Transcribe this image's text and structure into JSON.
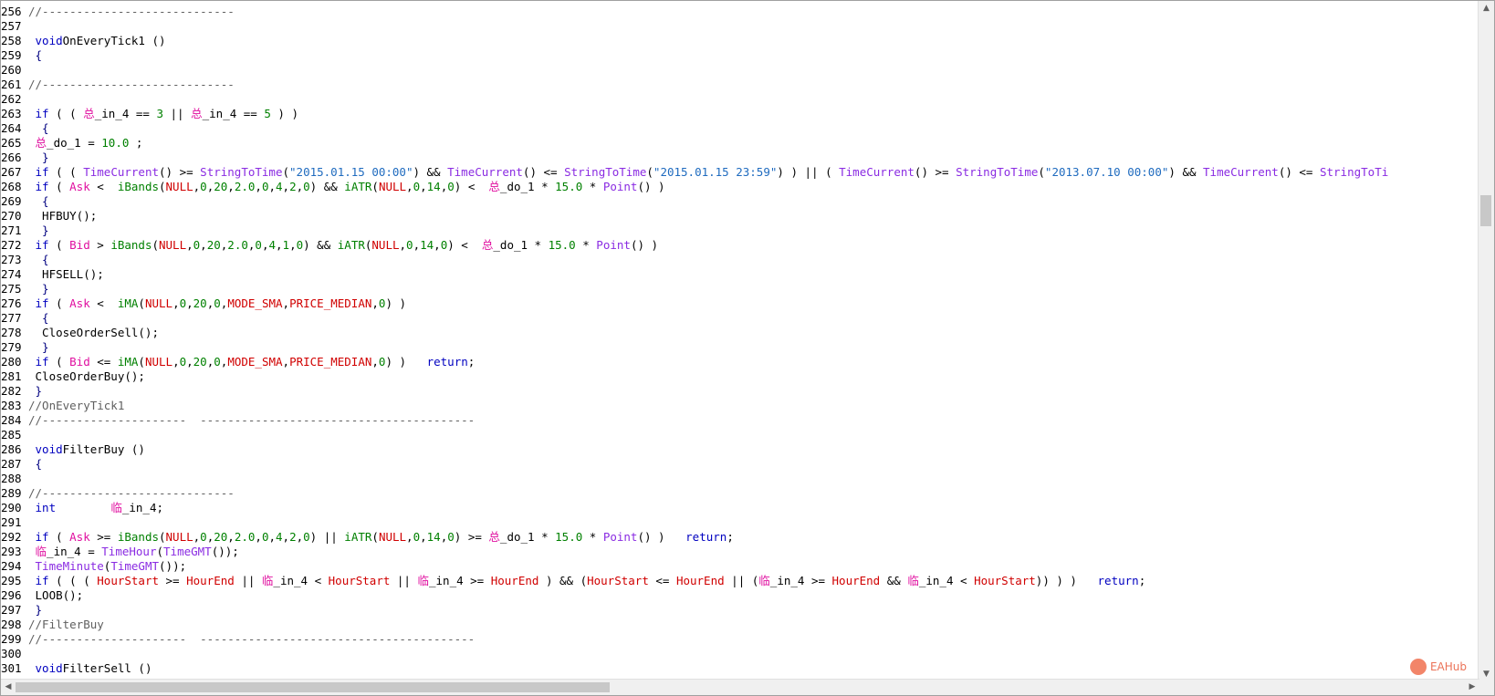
{
  "editor": {
    "lines": [
      {
        "n": "256",
        "t": [
          [
            "cm",
            "//----------------------------"
          ]
        ]
      },
      {
        "n": "257",
        "t": []
      },
      {
        "n": "258",
        "t": [
          [
            "kw",
            " void"
          ],
          [
            "",
            "OnEveryTick1 ()"
          ]
        ]
      },
      {
        "n": "259",
        "t": [
          [
            "op",
            " {"
          ]
        ]
      },
      {
        "n": "260",
        "t": []
      },
      {
        "n": "261",
        "t": [
          [
            "cm",
            "//----------------------------"
          ]
        ]
      },
      {
        "n": "262",
        "t": []
      },
      {
        "n": "263",
        "t": [
          [
            "kw",
            " if"
          ],
          [
            "",
            " ( ( "
          ],
          [
            "cjk",
            "总"
          ],
          [
            "",
            "_in_4 == "
          ],
          [
            "nm",
            "3"
          ],
          [
            "",
            " || "
          ],
          [
            "cjk",
            "总"
          ],
          [
            "",
            "_in_4 == "
          ],
          [
            "nm",
            "5"
          ],
          [
            "",
            " ) )"
          ]
        ]
      },
      {
        "n": "264",
        "t": [
          [
            "op",
            "  {"
          ]
        ]
      },
      {
        "n": "265",
        "t": [
          [
            "",
            " "
          ],
          [
            "cjk",
            "总"
          ],
          [
            "",
            "_do_1 = "
          ],
          [
            "nm",
            "10.0"
          ],
          [
            "",
            " ;"
          ]
        ]
      },
      {
        "n": "266",
        "t": [
          [
            "op",
            "  }"
          ]
        ]
      },
      {
        "n": "267",
        "t": [
          [
            "kw",
            " if"
          ],
          [
            "",
            " ( ( "
          ],
          [
            "fn",
            "TimeCurrent"
          ],
          [
            "",
            "() >= "
          ],
          [
            "fn",
            "StringToTime"
          ],
          [
            "",
            "("
          ],
          [
            "st",
            "\"2015.01.15 00:00\""
          ],
          [
            "",
            ") && "
          ],
          [
            "fn",
            "TimeCurrent"
          ],
          [
            "",
            "() <= "
          ],
          [
            "fn",
            "StringToTime"
          ],
          [
            "",
            "("
          ],
          [
            "st",
            "\"2015.01.15 23:59\""
          ],
          [
            "",
            ") ) || ( "
          ],
          [
            "fn",
            "TimeCurrent"
          ],
          [
            "",
            "() >= "
          ],
          [
            "fn",
            "StringToTime"
          ],
          [
            "",
            "("
          ],
          [
            "st",
            "\"2013.07.10 00:00\""
          ],
          [
            "",
            ") && "
          ],
          [
            "fn",
            "TimeCurrent"
          ],
          [
            "",
            "() <= "
          ],
          [
            "fn",
            "StringToTi"
          ]
        ]
      },
      {
        "n": "268",
        "t": [
          [
            "kw",
            " if"
          ],
          [
            "",
            " ( "
          ],
          [
            "pv",
            "Ask"
          ],
          [
            "",
            " <  "
          ],
          [
            "nm",
            "iBands"
          ],
          [
            "",
            "("
          ],
          [
            "cn",
            "NULL"
          ],
          [
            "",
            ","
          ],
          [
            "nm",
            "0"
          ],
          [
            "",
            ","
          ],
          [
            "nm",
            "20"
          ],
          [
            "",
            ","
          ],
          [
            "nm",
            "2.0"
          ],
          [
            "",
            ","
          ],
          [
            "nm",
            "0"
          ],
          [
            "",
            ","
          ],
          [
            "nm",
            "4"
          ],
          [
            "",
            ","
          ],
          [
            "nm",
            "2"
          ],
          [
            "",
            ","
          ],
          [
            "nm",
            "0"
          ],
          [
            "",
            ") && "
          ],
          [
            "nm",
            "iATR"
          ],
          [
            "",
            "("
          ],
          [
            "cn",
            "NULL"
          ],
          [
            "",
            ","
          ],
          [
            "nm",
            "0"
          ],
          [
            "",
            ","
          ],
          [
            "nm",
            "14"
          ],
          [
            "",
            ","
          ],
          [
            "nm",
            "0"
          ],
          [
            "",
            ") <  "
          ],
          [
            "cjk",
            "总"
          ],
          [
            "",
            "_do_1 * "
          ],
          [
            "nm",
            "15.0"
          ],
          [
            "",
            " * "
          ],
          [
            "fn",
            "Point"
          ],
          [
            "",
            "() )"
          ]
        ]
      },
      {
        "n": "269",
        "t": [
          [
            "op",
            "  {"
          ]
        ]
      },
      {
        "n": "270",
        "t": [
          [
            "",
            "  HFBUY();"
          ]
        ]
      },
      {
        "n": "271",
        "t": [
          [
            "op",
            "  }"
          ]
        ]
      },
      {
        "n": "272",
        "t": [
          [
            "kw",
            " if"
          ],
          [
            "",
            " ( "
          ],
          [
            "pv",
            "Bid"
          ],
          [
            "",
            " > "
          ],
          [
            "nm",
            "iBands"
          ],
          [
            "",
            "("
          ],
          [
            "cn",
            "NULL"
          ],
          [
            "",
            ","
          ],
          [
            "nm",
            "0"
          ],
          [
            "",
            ","
          ],
          [
            "nm",
            "20"
          ],
          [
            "",
            ","
          ],
          [
            "nm",
            "2.0"
          ],
          [
            "",
            ","
          ],
          [
            "nm",
            "0"
          ],
          [
            "",
            ","
          ],
          [
            "nm",
            "4"
          ],
          [
            "",
            ","
          ],
          [
            "nm",
            "1"
          ],
          [
            "",
            ","
          ],
          [
            "nm",
            "0"
          ],
          [
            "",
            ") && "
          ],
          [
            "nm",
            "iATR"
          ],
          [
            "",
            "("
          ],
          [
            "cn",
            "NULL"
          ],
          [
            "",
            ","
          ],
          [
            "nm",
            "0"
          ],
          [
            "",
            ","
          ],
          [
            "nm",
            "14"
          ],
          [
            "",
            ","
          ],
          [
            "nm",
            "0"
          ],
          [
            "",
            ") <  "
          ],
          [
            "cjk",
            "总"
          ],
          [
            "",
            "_do_1 * "
          ],
          [
            "nm",
            "15.0"
          ],
          [
            "",
            " * "
          ],
          [
            "fn",
            "Point"
          ],
          [
            "",
            "() )"
          ]
        ]
      },
      {
        "n": "273",
        "t": [
          [
            "op",
            "  {"
          ]
        ]
      },
      {
        "n": "274",
        "t": [
          [
            "",
            "  HFSELL();"
          ]
        ]
      },
      {
        "n": "275",
        "t": [
          [
            "op",
            "  }"
          ]
        ]
      },
      {
        "n": "276",
        "t": [
          [
            "kw",
            " if"
          ],
          [
            "",
            " ( "
          ],
          [
            "pv",
            "Ask"
          ],
          [
            "",
            " <  "
          ],
          [
            "nm",
            "iMA"
          ],
          [
            "",
            "("
          ],
          [
            "cn",
            "NULL"
          ],
          [
            "",
            ","
          ],
          [
            "nm",
            "0"
          ],
          [
            "",
            ","
          ],
          [
            "nm",
            "20"
          ],
          [
            "",
            ","
          ],
          [
            "nm",
            "0"
          ],
          [
            "",
            ","
          ],
          [
            "cn",
            "MODE_SMA"
          ],
          [
            "",
            ","
          ],
          [
            "cn",
            "PRICE_MEDIAN"
          ],
          [
            "",
            ","
          ],
          [
            "nm",
            "0"
          ],
          [
            "",
            ") )"
          ]
        ]
      },
      {
        "n": "277",
        "t": [
          [
            "op",
            "  {"
          ]
        ]
      },
      {
        "n": "278",
        "t": [
          [
            "",
            "  CloseOrderSell();"
          ]
        ]
      },
      {
        "n": "279",
        "t": [
          [
            "op",
            "  }"
          ]
        ]
      },
      {
        "n": "280",
        "t": [
          [
            "kw",
            " if"
          ],
          [
            "",
            " ( "
          ],
          [
            "pv",
            "Bid"
          ],
          [
            "",
            " <= "
          ],
          [
            "nm",
            "iMA"
          ],
          [
            "",
            "("
          ],
          [
            "cn",
            "NULL"
          ],
          [
            "",
            ","
          ],
          [
            "nm",
            "0"
          ],
          [
            "",
            ","
          ],
          [
            "nm",
            "20"
          ],
          [
            "",
            ","
          ],
          [
            "nm",
            "0"
          ],
          [
            "",
            ","
          ],
          [
            "cn",
            "MODE_SMA"
          ],
          [
            "",
            ","
          ],
          [
            "cn",
            "PRICE_MEDIAN"
          ],
          [
            "",
            ","
          ],
          [
            "nm",
            "0"
          ],
          [
            "",
            ") )   "
          ],
          [
            "kw",
            "return"
          ],
          [
            "",
            ";"
          ]
        ]
      },
      {
        "n": "281",
        "t": [
          [
            "",
            " CloseOrderBuy();"
          ]
        ]
      },
      {
        "n": "282",
        "t": [
          [
            "op",
            " }"
          ]
        ]
      },
      {
        "n": "283",
        "t": [
          [
            "cm",
            "//OnEveryTick1"
          ]
        ]
      },
      {
        "n": "284",
        "t": [
          [
            "cm",
            "//---------------------  ----------------------------------------"
          ]
        ]
      },
      {
        "n": "285",
        "t": []
      },
      {
        "n": "286",
        "t": [
          [
            "kw",
            " void"
          ],
          [
            "",
            "FilterBuy ()"
          ]
        ]
      },
      {
        "n": "287",
        "t": [
          [
            "op",
            " {"
          ]
        ]
      },
      {
        "n": "288",
        "t": []
      },
      {
        "n": "289",
        "t": [
          [
            "cm",
            "//----------------------------"
          ]
        ]
      },
      {
        "n": "290",
        "t": [
          [
            "kw",
            " int"
          ],
          [
            "",
            "        "
          ],
          [
            "cjk",
            "临"
          ],
          [
            "",
            "_in_4;"
          ]
        ]
      },
      {
        "n": "291",
        "t": []
      },
      {
        "n": "292",
        "t": [
          [
            "kw",
            " if"
          ],
          [
            "",
            " ( "
          ],
          [
            "pv",
            "Ask"
          ],
          [
            "",
            " >= "
          ],
          [
            "nm",
            "iBands"
          ],
          [
            "",
            "("
          ],
          [
            "cn",
            "NULL"
          ],
          [
            "",
            ","
          ],
          [
            "nm",
            "0"
          ],
          [
            "",
            ","
          ],
          [
            "nm",
            "20"
          ],
          [
            "",
            ","
          ],
          [
            "nm",
            "2.0"
          ],
          [
            "",
            ","
          ],
          [
            "nm",
            "0"
          ],
          [
            "",
            ","
          ],
          [
            "nm",
            "4"
          ],
          [
            "",
            ","
          ],
          [
            "nm",
            "2"
          ],
          [
            "",
            ","
          ],
          [
            "nm",
            "0"
          ],
          [
            "",
            ") || "
          ],
          [
            "nm",
            "iATR"
          ],
          [
            "",
            "("
          ],
          [
            "cn",
            "NULL"
          ],
          [
            "",
            ","
          ],
          [
            "nm",
            "0"
          ],
          [
            "",
            ","
          ],
          [
            "nm",
            "14"
          ],
          [
            "",
            ","
          ],
          [
            "nm",
            "0"
          ],
          [
            "",
            ") >= "
          ],
          [
            "cjk",
            "总"
          ],
          [
            "",
            "_do_1 * "
          ],
          [
            "nm",
            "15.0"
          ],
          [
            "",
            " * "
          ],
          [
            "fn",
            "Point"
          ],
          [
            "",
            "() )   "
          ],
          [
            "kw",
            "return"
          ],
          [
            "",
            ";"
          ]
        ]
      },
      {
        "n": "293",
        "t": [
          [
            "",
            " "
          ],
          [
            "cjk",
            "临"
          ],
          [
            "",
            "_in_4 = "
          ],
          [
            "fn",
            "TimeHour"
          ],
          [
            "",
            "("
          ],
          [
            "fn",
            "TimeGMT"
          ],
          [
            "",
            "());"
          ]
        ]
      },
      {
        "n": "294",
        "t": [
          [
            "",
            " "
          ],
          [
            "fn",
            "TimeMinute"
          ],
          [
            "",
            "("
          ],
          [
            "fn",
            "TimeGMT"
          ],
          [
            "",
            "());"
          ]
        ]
      },
      {
        "n": "295",
        "t": [
          [
            "kw",
            " if"
          ],
          [
            "",
            " ( ( ( "
          ],
          [
            "cn",
            "HourStart"
          ],
          [
            "",
            " >= "
          ],
          [
            "cn",
            "HourEnd"
          ],
          [
            "",
            " || "
          ],
          [
            "cjk",
            "临"
          ],
          [
            "",
            "_in_4 < "
          ],
          [
            "cn",
            "HourStart"
          ],
          [
            "",
            " || "
          ],
          [
            "cjk",
            "临"
          ],
          [
            "",
            "_in_4 >= "
          ],
          [
            "cn",
            "HourEnd"
          ],
          [
            "",
            " ) && ("
          ],
          [
            "cn",
            "HourStart"
          ],
          [
            "",
            " <= "
          ],
          [
            "cn",
            "HourEnd"
          ],
          [
            "",
            " || ("
          ],
          [
            "cjk",
            "临"
          ],
          [
            "",
            "_in_4 >= "
          ],
          [
            "cn",
            "HourEnd"
          ],
          [
            "",
            " && "
          ],
          [
            "cjk",
            "临"
          ],
          [
            "",
            "_in_4 < "
          ],
          [
            "cn",
            "HourStart"
          ],
          [
            "",
            ")) ) )   "
          ],
          [
            "kw",
            "return"
          ],
          [
            "",
            ";"
          ]
        ]
      },
      {
        "n": "296",
        "t": [
          [
            "",
            " LOOB();"
          ]
        ]
      },
      {
        "n": "297",
        "t": [
          [
            "op",
            " }"
          ]
        ]
      },
      {
        "n": "298",
        "t": [
          [
            "cm",
            "//FilterBuy"
          ]
        ]
      },
      {
        "n": "299",
        "t": [
          [
            "cm",
            "//---------------------  ----------------------------------------"
          ]
        ]
      },
      {
        "n": "300",
        "t": []
      },
      {
        "n": "301",
        "t": [
          [
            "kw",
            " void"
          ],
          [
            "",
            "FilterSell ()"
          ]
        ]
      }
    ]
  },
  "scrollbar": {
    "vertical_position": 0.29,
    "horizontal_position": 0.0,
    "horizontal_visible_fraction": 0.41
  },
  "watermark": {
    "text": "EAHub"
  },
  "icons": {
    "scroll_up": "▲",
    "scroll_down": "▼",
    "scroll_left": "◀",
    "scroll_right": "▶"
  },
  "colors": {
    "keyword": "#0000c0",
    "function": "#8a2be2",
    "number": "#008000",
    "string": "#1f6bbf",
    "constant": "#d00000",
    "predefined": "#e010a0",
    "comment": "#606060"
  }
}
